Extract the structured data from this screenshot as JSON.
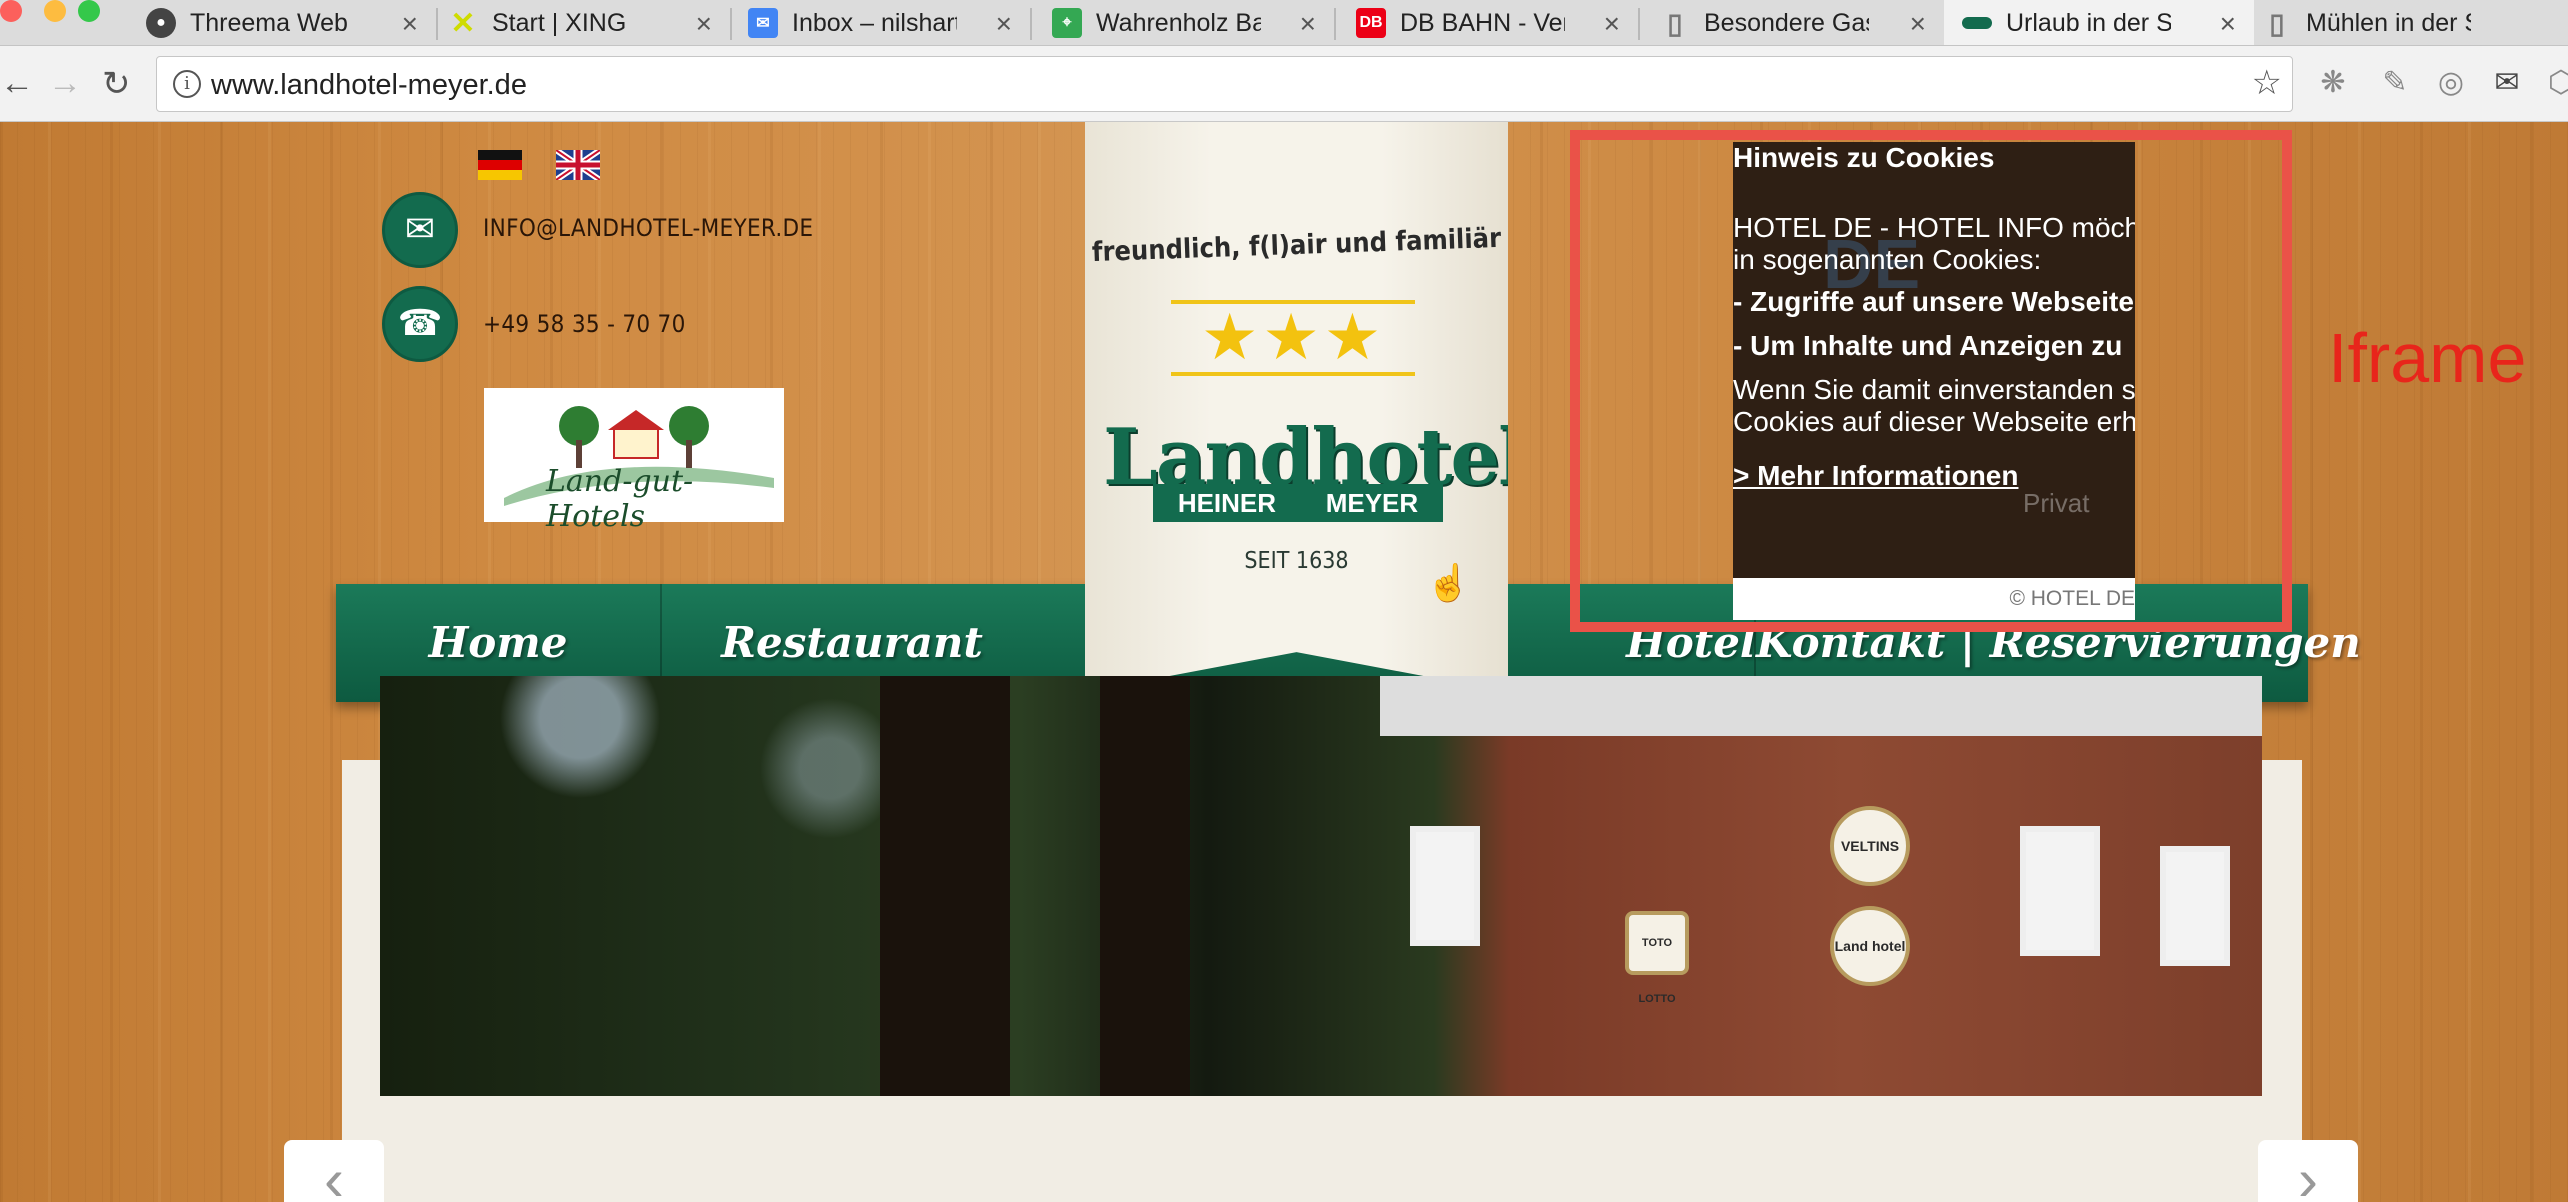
{
  "browser": {
    "tabs": [
      {
        "title": "Threema Web",
        "icon": "threema-icon",
        "color": "#444444"
      },
      {
        "title": "Start | XING",
        "icon": "xing-icon",
        "color": "#cfdc00"
      },
      {
        "title": "Inbox – nilshartm",
        "icon": "inbox-icon",
        "color": "#4285f4"
      },
      {
        "title": "Wahrenholz Bahn",
        "icon": "maps-icon",
        "color": "#34a853"
      },
      {
        "title": "DB BAHN - Verbi",
        "icon": "db-icon",
        "color": "#ec0016"
      },
      {
        "title": "Besondere Gastr",
        "icon": "page-icon",
        "color": "#777777"
      },
      {
        "title": "Urlaub in der Süd",
        "icon": "site-icon",
        "color": "#136b4e"
      },
      {
        "title": "Mühlen in der Süd",
        "icon": "page-icon",
        "color": "#777777"
      }
    ],
    "active_tab": 6,
    "url": "www.landhotel-meyer.de"
  },
  "header": {
    "email": "INFO@LANDHOTEL-MEYER.DE",
    "phone": "+49 58 35 - 70 70",
    "partner_logo": "Land-gut-Hotels"
  },
  "logo": {
    "slogan": "freundlich, f(l)air und familiär",
    "stars": "★★★",
    "name": "Landhotel",
    "sub_left": "HEINER",
    "sub_right": "MEYER",
    "since": "SEIT 1638"
  },
  "nav": {
    "items": [
      "Home",
      "Restaurant",
      "Hotel",
      "Kontakt | Reservierungen"
    ]
  },
  "cookie_notice": {
    "title": "Hinweis zu Cookies",
    "line1": "HOTEL DE - HOTEL INFO möch",
    "line2": "in sogenannten Cookies:",
    "bullet1": "- Zugriffe auf unsere Webseite",
    "bullet2": "- Um Inhalte und Anzeigen zu",
    "consent1": "Wenn Sie damit einverstanden s",
    "consent2": "Cookies auf dieser Webseite erh",
    "more_link": "> Mehr Informationen",
    "ghost_text": "DE",
    "ghost_privat": "Privat",
    "footer": "© HOTEL DE"
  },
  "annotation": {
    "label": "Iframe",
    "color": "#e8251b"
  },
  "slider": {
    "prev": "‹",
    "next": "›"
  },
  "photo_signs": {
    "sign1": "VELTINS",
    "sign2": "Land hotel",
    "sign3": "TOTO LOTTO"
  }
}
